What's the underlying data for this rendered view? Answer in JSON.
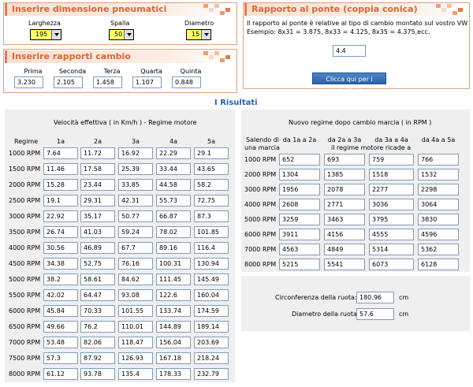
{
  "tires": {
    "title": "Inserire dimensione pneumatici",
    "width_label": "Larghezza",
    "width_value": "195",
    "profile_label": "Spalla",
    "profile_value": "50",
    "diameter_label": "Diametro",
    "diameter_value": "15"
  },
  "ratios": {
    "title": "Inserire rapporti cambio",
    "gears": [
      {
        "label": "Prima",
        "value": "3.230"
      },
      {
        "label": "Seconda",
        "value": "2.105"
      },
      {
        "label": "Terza",
        "value": "1.458"
      },
      {
        "label": "Quarta",
        "value": "1.107"
      },
      {
        "label": "Quinta",
        "value": "0.848"
      }
    ]
  },
  "final_drive": {
    "title": "Rapporto al ponte (coppia conica)",
    "description_1": "Il rapporto al ponte è relative al tipo di cambio montato sul vostro VW",
    "description_2": "Esempio: 8x31 = 3.875, 8x33 = 4.125, 8x35 = 4.375,ecc.",
    "value": "4.4",
    "button_label": "Clicca qui per i risultati"
  },
  "results": {
    "title": "I Risultati",
    "speed": {
      "title": "Velocità effettiva ( in Km/h ) - Regime motore",
      "row_header": "Regime",
      "columns": [
        "1a",
        "2a",
        "3a",
        "4a",
        "5a"
      ],
      "rows": [
        {
          "rpm": "1000 RPM",
          "values": [
            "7.64",
            "11.72",
            "16.92",
            "22.29",
            "29.1"
          ]
        },
        {
          "rpm": "1500 RPM",
          "values": [
            "11.46",
            "17.58",
            "25.39",
            "33.44",
            "43.65"
          ]
        },
        {
          "rpm": "2000 RPM",
          "values": [
            "15.28",
            "23.44",
            "33.85",
            "44.58",
            "58.2"
          ]
        },
        {
          "rpm": "2500 RPM",
          "values": [
            "19.1",
            "29.31",
            "42.31",
            "55.73",
            "72.75"
          ]
        },
        {
          "rpm": "3000 RPM",
          "values": [
            "22.92",
            "35.17",
            "50.77",
            "66.87",
            "87.3"
          ]
        },
        {
          "rpm": "3500 RPM",
          "values": [
            "26.74",
            "41.03",
            "59.24",
            "78.02",
            "101.85"
          ]
        },
        {
          "rpm": "4000 RPM",
          "values": [
            "30.56",
            "46.89",
            "67.7",
            "89.16",
            "116.4"
          ]
        },
        {
          "rpm": "4500 RPM",
          "values": [
            "34.38",
            "52.75",
            "76.16",
            "100.31",
            "130.94"
          ]
        },
        {
          "rpm": "5000 RPM",
          "values": [
            "38.2",
            "58.61",
            "84.62",
            "111.45",
            "145.49"
          ]
        },
        {
          "rpm": "5500 RPM",
          "values": [
            "42.02",
            "64.47",
            "93.08",
            "122.6",
            "160.04"
          ]
        },
        {
          "rpm": "6000 RPM",
          "values": [
            "45.84",
            "70.33",
            "101.55",
            "133.74",
            "174.59"
          ]
        },
        {
          "rpm": "6500 RPM",
          "values": [
            "49.66",
            "76.2",
            "110.01",
            "144.89",
            "189.14"
          ]
        },
        {
          "rpm": "7000 RPM",
          "values": [
            "53.48",
            "82.06",
            "118.47",
            "156.04",
            "203.69"
          ]
        },
        {
          "rpm": "7500 RPM",
          "values": [
            "57.3",
            "87.92",
            "126.93",
            "167.18",
            "218.24"
          ]
        },
        {
          "rpm": "8000 RPM",
          "values": [
            "61.12",
            "93.78",
            "135.4",
            "178.33",
            "232.79"
          ]
        }
      ]
    },
    "shift": {
      "title": "Nuovo regime dopo cambio marcia ( in RPM )",
      "row_header_1": "Salendo di",
      "row_header_2": "una marcia",
      "columns": [
        "da 1a a 2a",
        "da 2a a 3a",
        "da 3a a 4a",
        "da 4a a 5a"
      ],
      "subheader": "il regime motore ricade a",
      "rows": [
        {
          "rpm": "1000 RPM",
          "values": [
            "652",
            "693",
            "759",
            "766"
          ]
        },
        {
          "rpm": "2000 RPM",
          "values": [
            "1304",
            "1385",
            "1518",
            "1532"
          ]
        },
        {
          "rpm": "3000 RPM",
          "values": [
            "1956",
            "2078",
            "2277",
            "2298"
          ]
        },
        {
          "rpm": "4000 RPM",
          "values": [
            "2608",
            "2771",
            "3036",
            "3064"
          ]
        },
        {
          "rpm": "5000 RPM",
          "values": [
            "3259",
            "3463",
            "3795",
            "3830"
          ]
        },
        {
          "rpm": "6000 RPM",
          "values": [
            "3911",
            "4156",
            "4555",
            "4596"
          ]
        },
        {
          "rpm": "7000 RPM",
          "values": [
            "4563",
            "4849",
            "5314",
            "5362"
          ]
        },
        {
          "rpm": "8000 RPM",
          "values": [
            "5215",
            "5541",
            "6073",
            "6128"
          ]
        }
      ]
    },
    "wheel": {
      "circumference_label": "Circonferenza della ruota:",
      "circumference_value": "180.96",
      "circumference_unit": "cm",
      "diameter_label": "Diametro della ruota:",
      "diameter_value": "57.6",
      "diameter_unit": "cm"
    }
  },
  "colors": {
    "accent": "#d9663a",
    "result_title": "#2b5fa8",
    "select_bg": "#ffff66",
    "panel_bg": "#efefef"
  }
}
